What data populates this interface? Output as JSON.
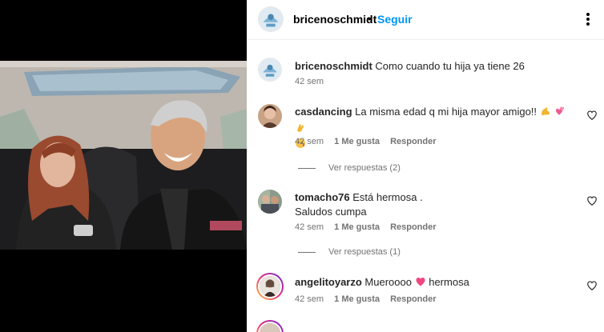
{
  "header": {
    "username": "bricenoschmidt",
    "dot": "•",
    "follow_label": "Seguir",
    "more_icon": "more-horizontal-icon"
  },
  "caption": {
    "username": "bricenoschmidt",
    "text": "Como cuando tu hija ya tiene 26",
    "time": "42 sem"
  },
  "comments": [
    {
      "username": "casdancing",
      "text_line1": "La misma edad q mi hija mayor amigo!!",
      "emojis": [
        "flexed-biceps-emoji",
        "two-hearts-emoji",
        "clapping-hands-emoji",
        "kiss-face-emoji"
      ],
      "time": "42 sem",
      "likes": "1 Me gusta",
      "reply": "Responder",
      "view_replies": "Ver respuestas (2)"
    },
    {
      "username": "tomacho76",
      "text_line1": "Está hermosa .",
      "text_line2": "Saludos cumpa",
      "time": "42 sem",
      "likes": "1 Me gusta",
      "reply": "Responder",
      "view_replies": "Ver respuestas (1)"
    },
    {
      "username": "angelitoyarzo",
      "text_before": "Mueroooo",
      "text_after": "hermosa",
      "emojis": [
        "pink-heart-emoji"
      ],
      "time": "42 sem",
      "likes": "1 Me gusta",
      "reply": "Responder"
    }
  ],
  "colors": {
    "link_blue": "#0095f6",
    "meta_gray": "#737373",
    "text": "#262626"
  }
}
